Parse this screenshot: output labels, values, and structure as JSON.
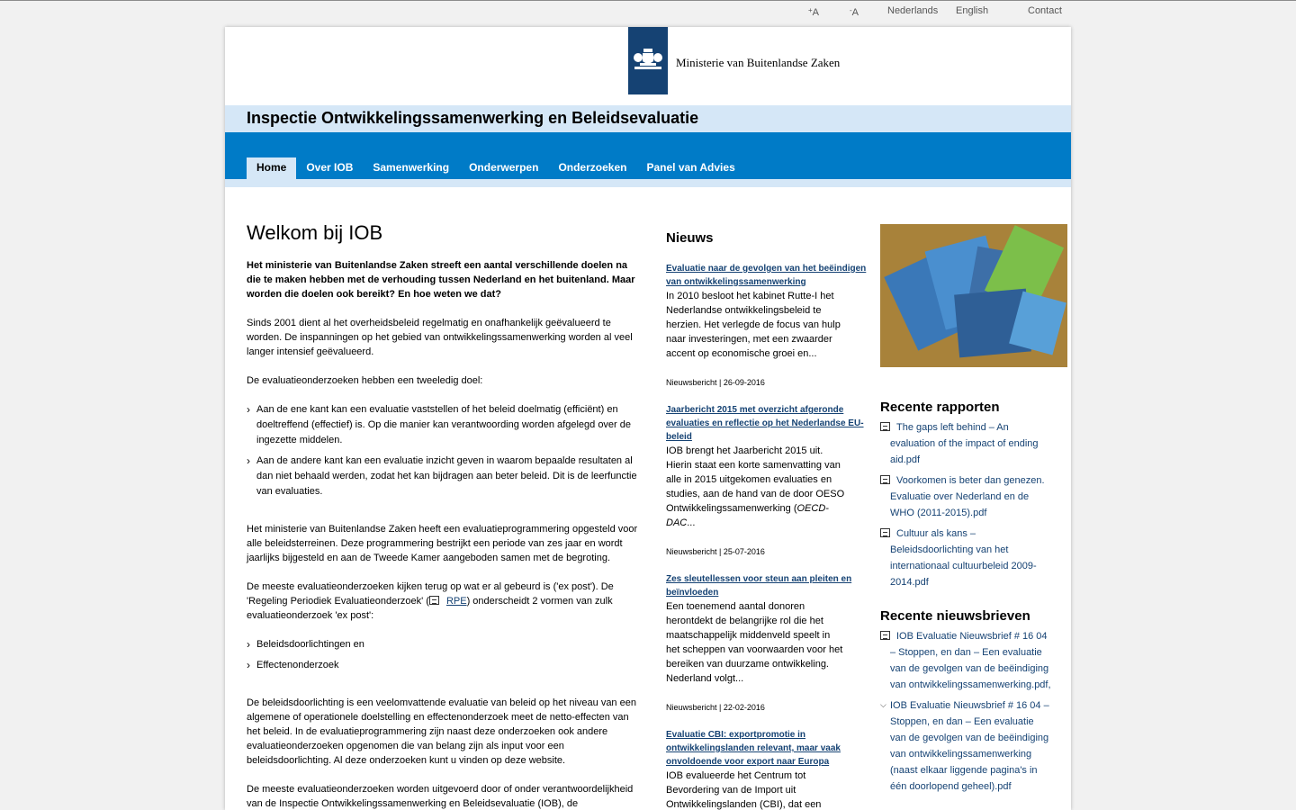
{
  "utility": {
    "text_larger": "A",
    "text_larger_sign": "+",
    "text_smaller": "A",
    "text_smaller_sign": "-",
    "lang_nl": "Nederlands",
    "lang_en": "English",
    "contact": "Contact"
  },
  "header": {
    "ministry": "Ministerie van Buitenlandse Zaken",
    "site_title": "Inspectie Ontwikkelingssamenwerking en Beleidsevaluatie"
  },
  "nav": [
    "Home",
    "Over IOB",
    "Samenwerking",
    "Onderwerpen",
    "Onderzoeken",
    "Panel van Advies"
  ],
  "main": {
    "heading": "Welkom bij IOB",
    "lead": "Het ministerie van Buitenlandse Zaken streeft een aantal verschillende doelen na die te maken hebben met de verhouding tussen Nederland en het buitenland. Maar worden die doelen ook bereikt? En hoe weten we dat?",
    "p1": "Sinds 2001 dient al het overheidsbeleid regelmatig en onafhankelijk geëvalueerd te worden. De inspanningen op het gebied van ontwikkelingssamenwerking worden al veel langer intensief geëvalueerd.",
    "p2": "De evaluatieonderzoeken hebben een tweeledig doel:",
    "list1": [
      "Aan de ene kant kan een evaluatie vaststellen of het beleid doelmatig (efficiënt) en doeltreffend (effectief) is. Op die manier kan verantwoording worden afgelegd over de ingezette middelen.",
      "Aan de andere kant kan een evaluatie inzicht geven in waarom bepaalde resultaten al dan niet behaald werden, zodat het kan bijdragen aan beter beleid. Dit is de leerfunctie van evaluaties."
    ],
    "p3": "Het ministerie van Buitenlandse Zaken heeft een evaluatieprogrammering opgesteld voor alle beleidsterreinen. Deze programmering bestrijkt een periode van zes jaar en wordt jaarlijks bijgesteld en aan de Tweede Kamer aangeboden samen met de begroting.",
    "p4_a": "De meeste evaluatieonderzoeken kijken terug op wat er al gebeurd is ('ex post'). De 'Regeling Periodiek Evaluatieonderzoek' (",
    "p4_link": "RPE",
    "p4_b": ") onderscheidt 2 vormen van zulk evaluatieonderzoek 'ex post':",
    "list2": [
      "Beleidsdoorlichtingen en",
      "Effectenonderzoek"
    ],
    "p5": "De beleidsdoorlichting is een veelomvattende evaluatie van beleid op het niveau van een algemene of operationele doelstelling en effectenonderzoek meet de netto-effecten van het beleid. In de evaluatieprogrammering zijn naast deze onderzoeken ook andere evaluatieonderzoeken opgenomen die van belang zijn als input voor een beleidsdoorlichting. Al deze onderzoeken kunt u vinden op deze website.",
    "p6": "De meeste evaluatieonderzoeken worden uitgevoerd door of onder verantwoordelijkheid van de Inspectie Ontwikkelingssamenwerking en Beleidsevaluatie (IOB), de"
  },
  "news": {
    "heading": "Nieuws",
    "items": [
      {
        "title": "Evaluatie naar de gevolgen van het beëindigen van ontwikkelingssamenwerking",
        "body": "In 2010 besloot het kabinet Rutte-I het Nederlandse ontwikkelingsbeleid te herzien. Het verlegde de focus van hulp naar investeringen, met een zwaarder accent op economische groei en...",
        "meta": "Nieuwsbericht | 26-09-2016"
      },
      {
        "title": "Jaarbericht 2015 met overzicht afgeronde evaluaties en reflectie op het Nederlandse EU-beleid",
        "body": "IOB brengt het Jaarbericht 2015 uit. Hierin staat een korte samenvatting van alle in 2015 uitgekomen evaluaties en studies, aan de hand van de door OESO Ontwikkelingssamenwerking (",
        "body_italic": "OECD-DAC",
        "body_end": "...",
        "meta": "Nieuwsbericht | 25-07-2016"
      },
      {
        "title": "Zes sleutellessen voor steun aan pleiten en beïnvloeden",
        "body": "Een toenemend aantal donoren herontdekt de belangrijke rol die het maatschappelijk middenveld speelt in het scheppen van voorwaarden voor het bereiken van duurzame ontwikkeling. Nederland volgt...",
        "meta": "Nieuwsbericht | 22-02-2016"
      },
      {
        "title": "Evaluatie CBI: exportpromotie in ontwikkelingslanden relevant, maar vaak onvoldoende voor export naar Europa",
        "body": "IOB evalueerde het Centrum tot Bevordering van de Import uit Ontwikkelingslanden (CBI), dat een"
      }
    ]
  },
  "sidebar": {
    "reports_heading": "Recente rapporten",
    "reports": [
      "The gaps left behind – An evaluation of the impact of ending aid.pdf",
      "Voorkomen is beter dan genezen. Evaluatie over Nederland en de WHO (2011-2015).pdf",
      "Cultuur als kans – Beleidsdoorlichting van het internationaal cultuurbeleid 2009-2014.pdf"
    ],
    "newsletters_heading": "Recente nieuwsbrieven",
    "newsletters": [
      "IOB Evaluatie Nieuwsbrief # 16 04 – Stoppen, en dan – Een evaluatie van de gevolgen van de beëindiging van ontwikkelingssamenwerking.pdf,",
      "IOB Evaluatie Nieuwsbrief # 16 04 – Stoppen, en dan – Een evaluatie van de gevolgen van de beëindiging van ontwikkelingssamenwerking (naast elkaar liggende pagina's in één doorlopend geheel).pdf"
    ]
  },
  "colors": {
    "brand_dark_blue": "#154273",
    "nav_blue": "#007bc7",
    "light_blue": "#d5e7f7"
  }
}
